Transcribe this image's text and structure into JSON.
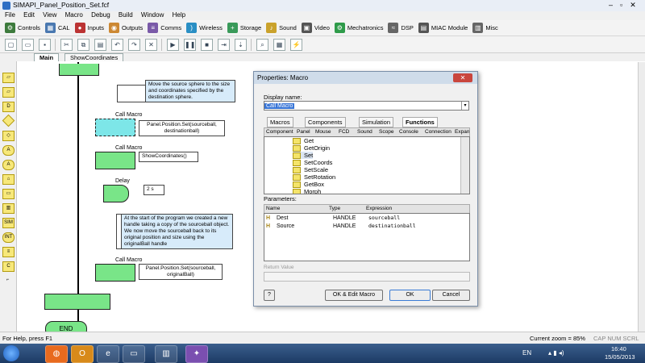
{
  "window": {
    "title": "SIMAPI_Panel_Position_Set.fcf"
  },
  "menu": [
    "File",
    "Edit",
    "View",
    "Macro",
    "Debug",
    "Build",
    "Window",
    "Help"
  ],
  "toolbar1": [
    "Controls",
    "CAL",
    "Inputs",
    "Outputs",
    "Comms",
    "Wireless",
    "Storage",
    "Sound",
    "Video",
    "Mechatronics",
    "DSP",
    "MIAC Module",
    "Misc"
  ],
  "tabs": {
    "main": "Main",
    "show": "ShowCoordinates"
  },
  "canvas": {
    "comment1": "Move the source sphere to the size and coordinates  specified by the destination sphere.",
    "callMacro1": "Call Macro",
    "call1": "Panel.Position.Set(sourceball, destinationball)",
    "callMacro2": "Call Macro",
    "call2": "ShowCoordinates()",
    "delayLabel": "Delay",
    "delayValue": "2 s",
    "comment2": "At the start of the program we created a new handle taking a copy of the sourceball object. We now move the sourceball back to its original position and size using the originalBall handle",
    "callMacro3": "Call Macro",
    "call3": "Panel.Position.Set(sourceball, originalBall)",
    "end": "END"
  },
  "dialog": {
    "title": "Properties: Macro",
    "displayNameLabel": "Display name:",
    "displayNameValue": "Call Macro",
    "subtabs": [
      "Macros",
      "Components",
      "Simulation",
      "Functions"
    ],
    "columns": [
      "Component",
      "Panel",
      "Mouse",
      "FCD",
      "Sound",
      "Scope",
      "Console",
      "Connection",
      "Expanc"
    ],
    "items": [
      "Get",
      "GetOrigin",
      "Set",
      "SetCoords",
      "SetScale",
      "SetRotation",
      "GetBox",
      "Morph"
    ],
    "paramsLabel": "Parameters:",
    "paramHeaders": [
      "Name",
      "Type",
      "Expression"
    ],
    "params": [
      {
        "name": "Dest",
        "type": "HANDLE",
        "expr": "sourceball"
      },
      {
        "name": "Source",
        "type": "HANDLE",
        "expr": "destinationball"
      }
    ],
    "returnLabel": "Return Value",
    "help": "?",
    "okEdit": "OK & Edit Macro",
    "ok": "OK",
    "cancel": "Cancel"
  },
  "status": {
    "left": "For Help, press F1",
    "zoom": "Current zoom = 85%",
    "caps": "CAP  NUM  SCRL"
  },
  "taskbar": {
    "lang": "EN",
    "time": "16:40",
    "date": "15/05/2013"
  }
}
